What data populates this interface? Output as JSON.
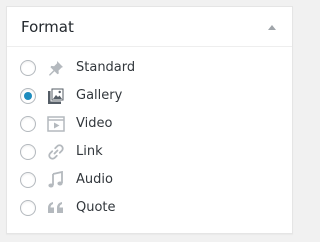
{
  "panel": {
    "title": "Format",
    "toggle_icon": "triangle-up-icon"
  },
  "formats": [
    {
      "label": "Standard",
      "icon": "pin-icon",
      "selected": false
    },
    {
      "label": "Gallery",
      "icon": "gallery-icon",
      "selected": true
    },
    {
      "label": "Video",
      "icon": "video-icon",
      "selected": false
    },
    {
      "label": "Link",
      "icon": "link-icon",
      "selected": false
    },
    {
      "label": "Audio",
      "icon": "audio-icon",
      "selected": false
    },
    {
      "label": "Quote",
      "icon": "quote-icon",
      "selected": false
    }
  ],
  "colors": {
    "accent": "#1e8cbe",
    "icon_gray": "#b4b9be",
    "gallery_icon": "#555d66",
    "text": "#32373c"
  }
}
